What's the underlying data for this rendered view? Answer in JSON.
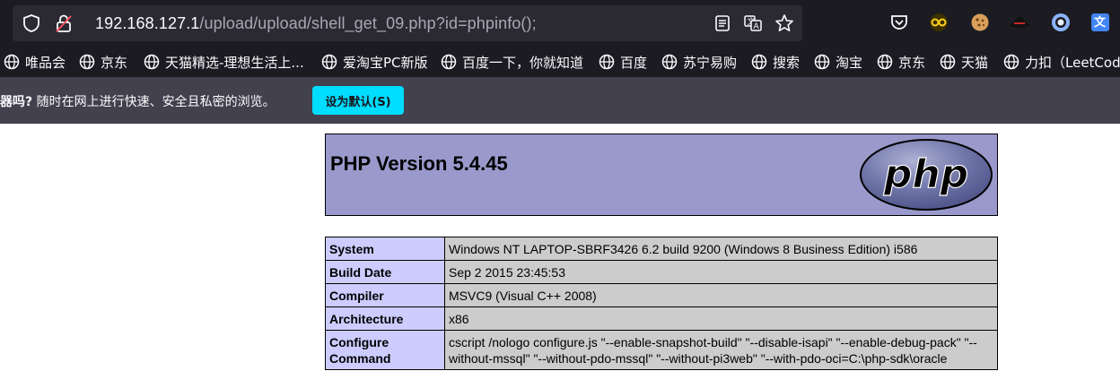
{
  "browser": {
    "url": {
      "host": "192.168.127.1",
      "path": "/upload/upload/shell_get_09.php?id=phpinfo();"
    },
    "bookmarks": [
      {
        "label": "唯品会"
      },
      {
        "label": "京东"
      },
      {
        "label": "天猫精选-理想生活上..."
      },
      {
        "label": "爱淘宝PC新版"
      },
      {
        "label": "百度一下，你就知道"
      },
      {
        "label": "百度"
      },
      {
        "label": "苏宁易购"
      },
      {
        "label": "搜索"
      },
      {
        "label": "淘宝"
      },
      {
        "label": "京东"
      },
      {
        "label": "天猫"
      },
      {
        "label": "力扣（LeetCode"
      }
    ],
    "notice": {
      "lead": "器吗?",
      "text": " 随时在网上进行快速、安全且私密的浏览。",
      "button": "设为默认(S)"
    },
    "icons": {
      "toolbar": [
        "pocket-icon",
        "extension-mask-icon",
        "cookie-icon",
        "spy-hat-icon",
        "circle-extension-icon",
        "translate-extension-icon"
      ]
    },
    "colors": {
      "chrome_dark": "#1c1b22",
      "urlbar": "#2b2a33",
      "notice_bar": "#42414d",
      "accent": "#00ddff"
    }
  },
  "phpinfo": {
    "title": "PHP Version 5.4.45",
    "logo_text": "php",
    "rows": [
      {
        "key": "System",
        "value": "Windows NT LAPTOP-SBRF3426 6.2 build 9200 (Windows 8 Business Edition) i586"
      },
      {
        "key": "Build Date",
        "value": "Sep 2 2015 23:45:53"
      },
      {
        "key": "Compiler",
        "value": "MSVC9 (Visual C++ 2008)"
      },
      {
        "key": "Architecture",
        "value": "x86"
      },
      {
        "key": "Configure Command",
        "value": "cscript /nologo configure.js \"--enable-snapshot-build\" \"--disable-isapi\" \"--enable-debug-pack\" \"--without-mssql\" \"--without-pdo-mssql\" \"--without-pi3web\" \"--with-pdo-oci=C:\\php-sdk\\oracle"
      }
    ],
    "colors": {
      "header_bg": "#9999cc",
      "key_bg": "#ccccff",
      "value_bg": "#cccccc"
    }
  }
}
